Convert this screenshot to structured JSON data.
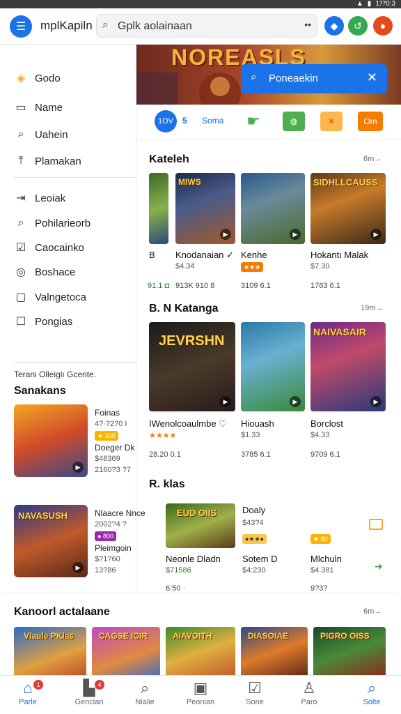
{
  "status_bar": {
    "time": "1⁇0:3"
  },
  "header": {
    "app_title": "mplKapiln",
    "search": {
      "value": "Gplk aolainaan",
      "placeholder": "Gplk aolainaan"
    }
  },
  "drawer": {
    "items": [
      {
        "label": "Godo",
        "icon": "home-icon"
      },
      {
        "label": "Name",
        "icon": "square-icon"
      },
      {
        "label": "Uahein",
        "icon": "search-icon"
      },
      {
        "label": "Plamakan",
        "icon": "upload-icon"
      },
      {
        "label": "Leoiak",
        "icon": "arrow-icon"
      },
      {
        "label": "Pohilarieorb",
        "icon": "search-icon"
      },
      {
        "label": "Caocainko",
        "icon": "check-icon"
      },
      {
        "label": "Boshace",
        "icon": "circle-icon"
      },
      {
        "label": "Valngetoca",
        "icon": "chat-icon"
      },
      {
        "label": "Pongias",
        "icon": "square-icon"
      }
    ],
    "small_text": "Terani Olleiglı Gcente.",
    "heading": "Sanakans",
    "cards": [
      {
        "lines": [
          "Foinas",
          "4?·?2?0 I",
          "",
          "Doeger Dk",
          "$48369",
          "2160?3 ?7"
        ],
        "badge": "300"
      },
      {
        "lines": [
          "Nlaacre Nnce",
          "2002?4 ?",
          "",
          "Pleimgoin",
          "$?1?60",
          "13?86"
        ],
        "badge": "800"
      }
    ]
  },
  "hero": {
    "title": "NOREASLS",
    "button_label": "Poneaekin",
    "button_icon": "search-icon"
  },
  "chips": {
    "active": "1OV",
    "count": "5",
    "text": "Soma",
    "box": "Om"
  },
  "sections": [
    {
      "title": "Kateleh",
      "more": "6m→",
      "games": [
        {
          "name": "B",
          "sub": "",
          "stat": "91.1 ◘"
        },
        {
          "name": "Knodanaian ✓",
          "sub": "$4.34",
          "stat": "913K   910 8"
        },
        {
          "name": "Kenhe",
          "sub": "",
          "stat": "3109   6.1"
        },
        {
          "name": "Hokantı Malak",
          "sub": "$7.30",
          "stat": "1763   6.1"
        }
      ],
      "card_titles": [
        "",
        "MIWS",
        "",
        "SIDHLLCAUSS"
      ]
    },
    {
      "title": "B. N Katanga",
      "more": "19m→",
      "games": [
        {
          "name": "IWenolcoaulmbe ♡",
          "sub": "★★★★",
          "stat": "28.20   0.1"
        },
        {
          "name": "Hiouash",
          "sub": "$1.33",
          "stat": "3785   6.1"
        },
        {
          "name": "Borclost",
          "sub": "$4.33",
          "stat": "9709   6.1"
        }
      ],
      "card_titles": [
        "JEVRSHN",
        "",
        "NAIVASAIR"
      ]
    },
    {
      "title": "R. klas",
      "more": "",
      "games": [
        {
          "name": "Neonle Dladn",
          "sub": "$71586",
          "stat": "6:50   ·"
        },
        {
          "name": "Sotem D",
          "sub": "$4:230",
          "stat": ""
        },
        {
          "name": "Mlchuln",
          "sub": "$4.381",
          "stat": "9?3?"
        }
      ],
      "card_titles": [
        "EUD OIIS"
      ],
      "extra": {
        "name": "Doaly",
        "sub": "$43?4"
      }
    }
  ],
  "bottom_section": {
    "title": "Kanoorl actalaane",
    "more": "6m→",
    "card_titles": [
      "Vlaule PKlas",
      "CAGSE ICIR",
      "AIAVOITH",
      "DIASOIAE",
      "PIGRO OISS"
    ]
  },
  "nav": [
    {
      "label": "Parle",
      "icon": "home-icon",
      "badge": "1"
    },
    {
      "label": "Genclan",
      "icon": "store-icon",
      "badge": "4"
    },
    {
      "label": "Nialie",
      "icon": "search-icon"
    },
    {
      "label": "Peonian",
      "icon": "tablet-icon"
    },
    {
      "label": "Sone",
      "icon": "note-icon"
    },
    {
      "label": "Paro",
      "icon": "user-icon"
    },
    {
      "label": "Solte",
      "icon": "search-icon"
    }
  ]
}
